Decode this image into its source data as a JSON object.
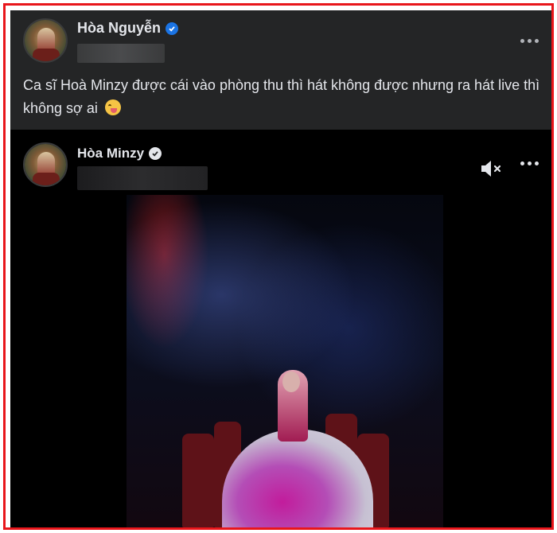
{
  "outer_post": {
    "author": "Hòa Nguyễn",
    "verified_icon": "blue-check-icon",
    "caption": "Ca sĩ Hoà Minzy được cái vào phòng thu thì hát không được nhưng ra hát live thì không sợ ai",
    "caption_emoji": "winking-tongue-emoji"
  },
  "shared_post": {
    "author": "Hòa Minzy",
    "verified_icon": "check-badge-icon",
    "video": {
      "muted": true,
      "mute_icon": "speaker-muted-icon"
    }
  },
  "menu_icon": "more-options-icon",
  "colors": {
    "frame_border": "#e8161b",
    "post_bg": "#242526",
    "video_bg": "#000000",
    "text": "#e4e6eb",
    "verified_blue": "#1b74e4"
  }
}
